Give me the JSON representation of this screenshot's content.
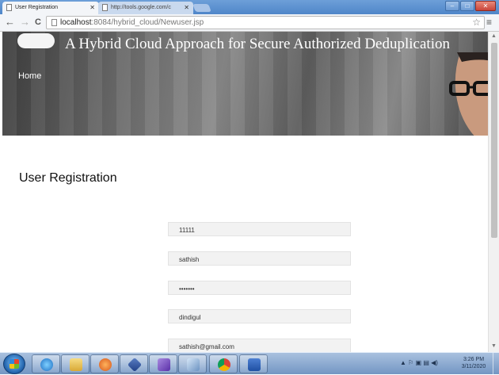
{
  "browser": {
    "tabs": [
      {
        "label": "User Registration",
        "active": true
      },
      {
        "label": "http://tools.google.com/c",
        "active": false
      }
    ],
    "url_host": "localhost",
    "url_path": ":8084/hybrid_cloud/Newuser.jsp",
    "nav": {
      "back": "←",
      "forward": "→",
      "reload": "C"
    },
    "star_glyph": "☆",
    "menu_glyph": "≡",
    "window_controls": {
      "minimize": "–",
      "maximize": "□",
      "close": "✕"
    }
  },
  "site": {
    "title": "A Hybrid Cloud Approach for Secure Authorized Deduplication",
    "nav_home": "Home"
  },
  "page": {
    "heading": "User Registration",
    "fields": [
      {
        "value": "11111"
      },
      {
        "value": "sathish"
      },
      {
        "value": "•••••••"
      },
      {
        "value": "dindigul"
      },
      {
        "value": "sathish@gmail.com"
      }
    ]
  },
  "taskbar": {
    "apps": [
      "internet-explorer-icon",
      "folder-icon",
      "media-player-icon",
      "virtualbox-icon",
      "visual-studio-icon",
      "drafting-icon",
      "chrome-icon",
      "word-icon"
    ],
    "tray_glyphs": "▲ ⚐ ▣ ▤ ◀)",
    "time": "3:26 PM",
    "date": "3/11/2020"
  },
  "colors": {
    "field_bg": "#f2f2f2",
    "taskbar": "#7396c3",
    "tab_strip": "#4f86c9"
  }
}
